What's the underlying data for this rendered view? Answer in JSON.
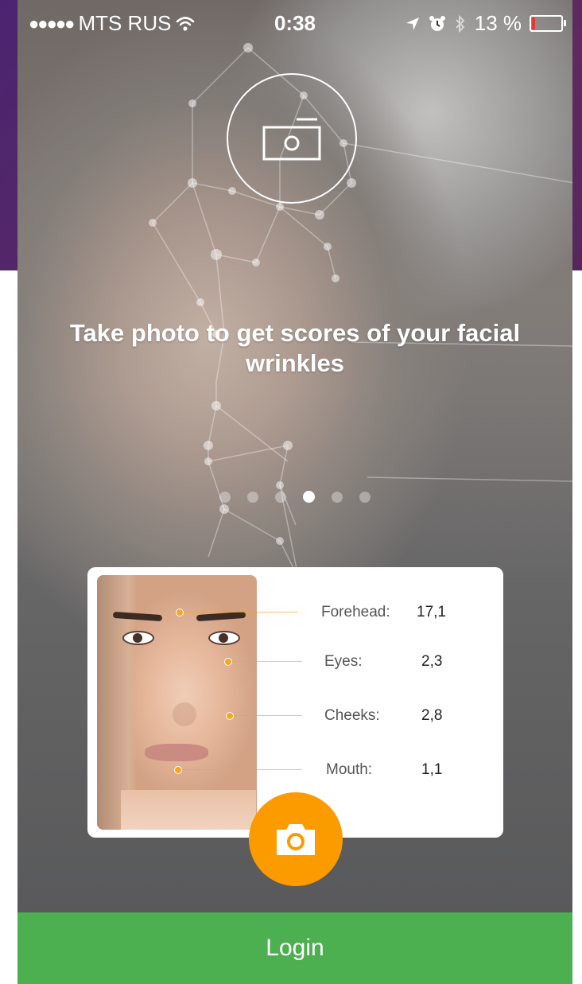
{
  "status_bar": {
    "signal_dots": "●●●●●",
    "carrier": "MTS RUS",
    "wifi_icon": "wifi-icon",
    "time": "0:38",
    "location_icon": "location-arrow-icon",
    "alarm_icon": "alarm-clock-icon",
    "bluetooth_icon": "bluetooth-icon",
    "battery_text": "13 %",
    "battery_level": 0.13
  },
  "intro": {
    "camera_icon": "camera-icon",
    "headline": "Take photo to get scores of your facial wrinkles"
  },
  "pager": {
    "count": 6,
    "active_index": 3
  },
  "scores": [
    {
      "label": "Forehead:",
      "value": "17,1"
    },
    {
      "label": "Eyes:",
      "value": "2,3"
    },
    {
      "label": "Cheeks:",
      "value": "2,8"
    },
    {
      "label": "Mouth:",
      "value": "1,1"
    }
  ],
  "fab": {
    "icon": "camera-icon"
  },
  "login": {
    "label": "Login"
  },
  "colors": {
    "accent_orange": "#fb9b00",
    "login_green": "#4caf50",
    "slide_purple": "#5b2a63",
    "battery_red": "#e53935"
  }
}
